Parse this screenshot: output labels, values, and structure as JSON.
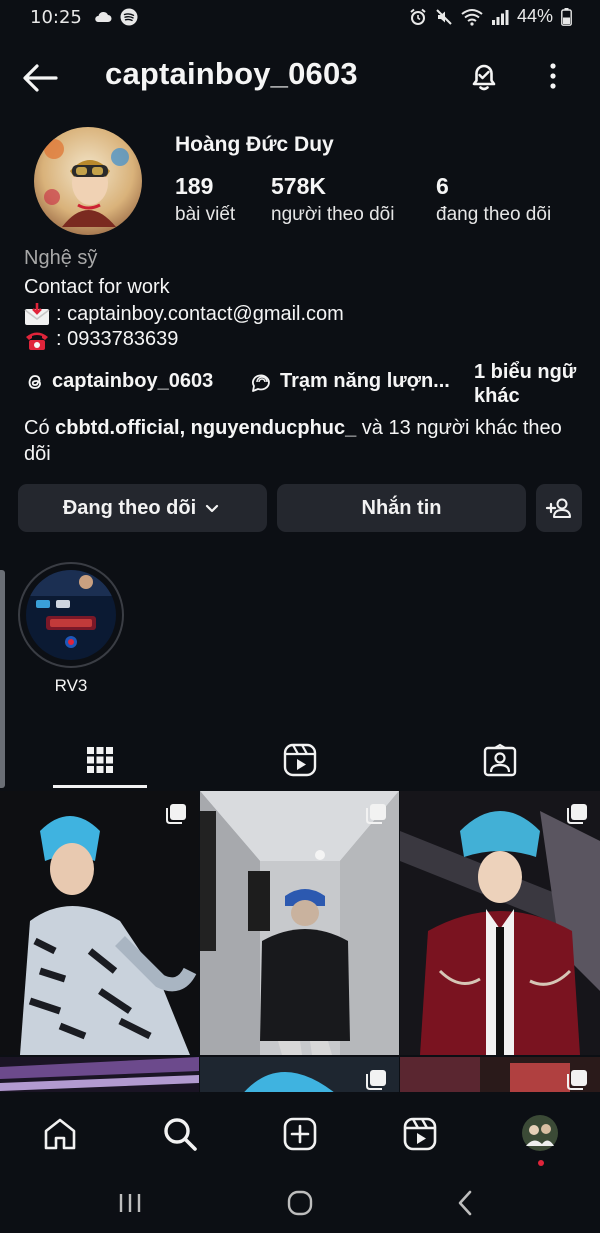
{
  "status_bar": {
    "time": "10:25",
    "battery": "44%"
  },
  "header": {
    "username": "captainboy_0603"
  },
  "profile": {
    "full_name": "Hoàng Đức Duy",
    "stats": [
      {
        "value": "189",
        "label": "bài viết"
      },
      {
        "value": "578K",
        "label": "người theo dõi"
      },
      {
        "value": "6",
        "label": "đang theo dõi"
      }
    ],
    "category": "Nghệ sỹ",
    "bio_line1": "Contact for work",
    "bio_email": ": captainboy.contact@gmail.com",
    "bio_phone": ": 0933783639",
    "threads_handle": "captainboy_0603",
    "channel_name": "Trạm năng lượn...",
    "more_languages": "1 biểu ngữ khác",
    "followed_by_prefix": "Có ",
    "followed_by_names": "cbbtd.official, nguyenducphuc_",
    "followed_by_suffix": " và 13 người khác theo dõi"
  },
  "actions": {
    "following_label": "Đang theo dõi",
    "message_label": "Nhắn tin"
  },
  "highlights": [
    {
      "label": "RV3"
    }
  ],
  "tabs": [
    {
      "icon": "grid-icon",
      "active": true
    },
    {
      "icon": "reels-icon",
      "active": false
    },
    {
      "icon": "tagged-icon",
      "active": false
    }
  ],
  "colors": {
    "background": "#0c0f14",
    "button": "#24272e",
    "muted_text": "#a8a8a8",
    "notification_dot": "#e0243a"
  },
  "bottom_nav": [
    {
      "icon": "home-icon"
    },
    {
      "icon": "search-icon"
    },
    {
      "icon": "create-icon"
    },
    {
      "icon": "reels-icon"
    },
    {
      "icon": "profile-avatar"
    }
  ]
}
